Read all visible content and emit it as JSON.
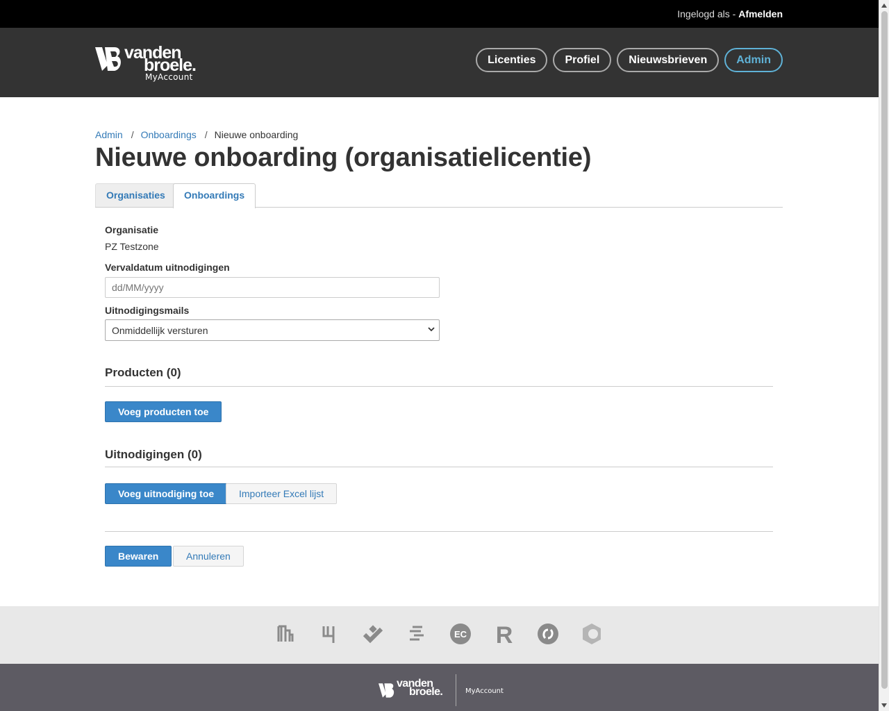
{
  "topbar": {
    "logged_in_as": "Ingelogd als - ",
    "logout": "Afmelden"
  },
  "logo": {
    "word1": "vanden",
    "word2": "broele.",
    "sub": "MyAccount"
  },
  "nav": [
    {
      "label": "Licenties"
    },
    {
      "label": "Profiel"
    },
    {
      "label": "Nieuwsbrieven"
    },
    {
      "label": "Admin",
      "active": true
    }
  ],
  "breadcrumb": {
    "admin": "Admin",
    "onboardings": "Onboardings",
    "current": "Nieuwe onboarding",
    "separator": "/"
  },
  "page_title": "Nieuwe onboarding (organisatielicentie)",
  "tabs": [
    {
      "label": "Organisaties"
    },
    {
      "label": "Onboardings",
      "active": true
    }
  ],
  "form": {
    "organisation_label": "Organisatie",
    "organisation_value": "PZ Testzone",
    "expiry_label": "Vervaldatum uitnodigingen",
    "expiry_placeholder": "dd/MM/yyyy",
    "mails_label": "Uitnodigingsmails",
    "mails_value": "Onmiddellijk versturen"
  },
  "products": {
    "heading": "Producten (0)",
    "add_button": "Voeg producten toe"
  },
  "invitations": {
    "heading": "Uitnodigingen (0)",
    "add_button": "Voeg uitnodiging toe",
    "import_button": "Importeer Excel lijst"
  },
  "actions": {
    "save": "Bewaren",
    "cancel": "Annuleren"
  },
  "footer": {
    "brand_icons": [
      "brand-icon-1",
      "brand-icon-2",
      "brand-icon-3",
      "brand-icon-4",
      "brand-icon-ec",
      "brand-icon-r",
      "brand-icon-6",
      "brand-icon-8"
    ],
    "brand_ec_text": "EC",
    "brand_r_text": "R",
    "logo_word1": "vanden",
    "logo_word2": "broele.",
    "logo_sub": "MyAccount"
  },
  "colors": {
    "accent": "#3a87c9",
    "header_bg": "#333333",
    "active_nav": "#5fb2d7",
    "footer_bg": "#5d5b63"
  }
}
